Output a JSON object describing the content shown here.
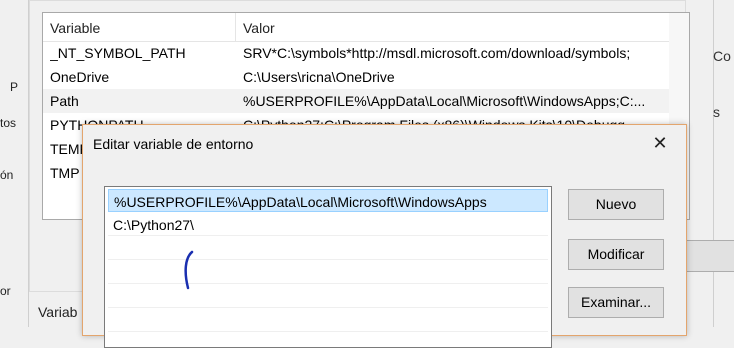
{
  "background_left": {
    "fragments": [
      "P",
      "tos",
      "ón",
      "or"
    ]
  },
  "env_dialog": {
    "list_headers": {
      "variable": "Variable",
      "value": "Valor"
    },
    "rows": [
      {
        "variable": "_NT_SYMBOL_PATH",
        "value": "SRV*C:\\symbols*http://msdl.microsoft.com/download/symbols;"
      },
      {
        "variable": "OneDrive",
        "value": "C:\\Users\\ricna\\OneDrive"
      },
      {
        "variable": "Path",
        "value": "%USERPROFILE%\\AppData\\Local\\Microsoft\\WindowsApps;C:..."
      },
      {
        "variable": "PYTHONPATH",
        "value": "C:\\Python27;C:\\Program Files (x86)\\Windows Kits\\10\\Debugg..."
      },
      {
        "variable": "TEMP",
        "value": ""
      },
      {
        "variable": "TMP",
        "value": ""
      }
    ],
    "system_vars_label": "Variab"
  },
  "right_fragments": [
    "Co",
    "s"
  ],
  "edit_dialog": {
    "title": "Editar variable de entorno",
    "close_glyph": "✕",
    "entries": [
      "%USERPROFILE%\\AppData\\Local\\Microsoft\\WindowsApps",
      "C:\\Python27\\"
    ],
    "buttons": {
      "new": "Nuevo",
      "edit": "Modificar",
      "browse": "Examinar..."
    }
  },
  "colors": {
    "selection": "#cce8ff",
    "dialog_border": "#e3a56d",
    "ink_annotation": "#1a2fb0"
  }
}
